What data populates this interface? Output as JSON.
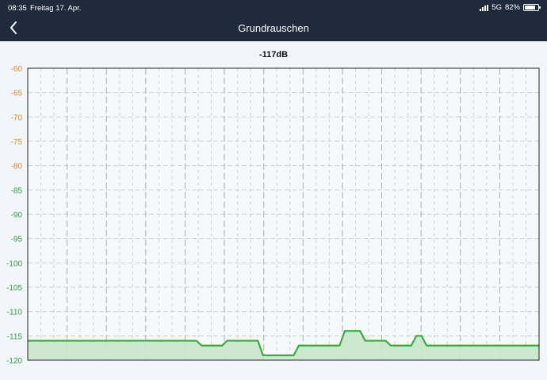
{
  "status_bar": {
    "time": "08:35",
    "date": "Freitag 17. Apr.",
    "network": "5G",
    "battery_text": "82%",
    "battery_level": 0.82
  },
  "nav": {
    "title": "Grundrauschen",
    "back_icon": "chevron-left-icon"
  },
  "colors": {
    "header_bg": "#1f2a3c",
    "line": "#3daa48",
    "fill": "#c8e6c9",
    "tick_orange": "#e08a1e",
    "tick_green": "#2f9e44"
  },
  "current_value": "-117dB",
  "chart_data": {
    "type": "area",
    "ylim": [
      -120,
      -60
    ],
    "yticks": [
      "-60",
      "-65",
      "-70",
      "-75",
      "-80",
      "-85",
      "-90",
      "-95",
      "-100",
      "-105",
      "-110",
      "-115",
      "-120"
    ],
    "grid": true,
    "x": [
      0,
      33,
      34,
      38,
      39,
      45,
      46,
      52,
      53,
      61,
      62,
      65,
      66,
      70,
      71,
      75,
      76,
      77,
      78,
      100
    ],
    "series": [
      {
        "values": [
          -116,
          -116,
          -117,
          -117,
          -116,
          -116,
          -119,
          -119,
          -117,
          -117,
          -114,
          -114,
          -116,
          -116,
          -117,
          -117,
          -115,
          -115,
          -117,
          -117
        ]
      }
    ]
  }
}
